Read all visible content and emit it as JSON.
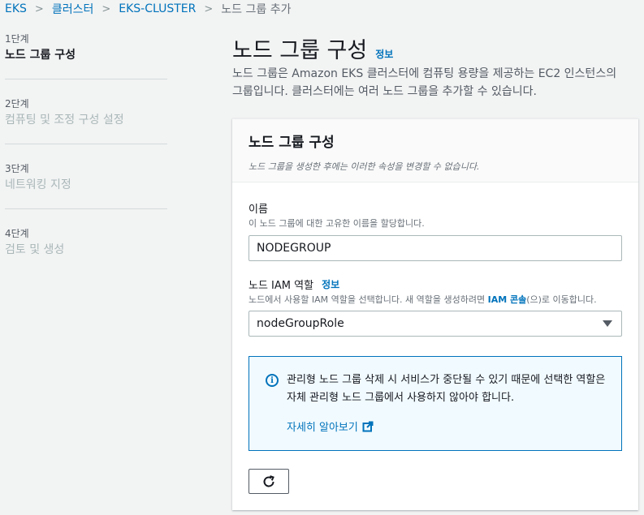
{
  "breadcrumb": {
    "items": [
      "EKS",
      "클러스터",
      "EKS-CLUSTER"
    ],
    "current": "노드 그룹 추가"
  },
  "steps": [
    {
      "num": "1단계",
      "label": "노드 그룹 구성",
      "active": true
    },
    {
      "num": "2단계",
      "label": "컴퓨팅 및 조정 구성 설정",
      "active": false
    },
    {
      "num": "3단계",
      "label": "네트워킹 지정",
      "active": false
    },
    {
      "num": "4단계",
      "label": "검토 및 생성",
      "active": false
    }
  ],
  "page": {
    "title": "노드 그룹 구성",
    "info": "정보",
    "desc_line1": "노드 그룹은 Amazon EKS 클러스터에 컴퓨팅 용량을 제공하는 EC2 인스턴스의",
    "desc_line2": "그룹입니다. 클러스터에는 여러 노드 그룹을 추가할 수 있습니다."
  },
  "panel": {
    "title": "노드 그룹 구성",
    "subtitle": "노드 그룹을 생성한 후에는 이러한 속성을 변경할 수 없습니다."
  },
  "name_field": {
    "label": "이름",
    "desc": "이 노드 그룹에 대한 고유한 이름을 할당합니다.",
    "value": "NODEGROUP"
  },
  "role_field": {
    "label": "노드 IAM 역할",
    "info": "정보",
    "desc_before": "노드에서 사용할 IAM 역할을 선택합니다. 새 역할을 생성하려면 ",
    "desc_link": "IAM 콘솔",
    "desc_after": "(으)로 이동합니다.",
    "value": "nodeGroupRole"
  },
  "alert": {
    "text": "관리형 노드 그룹 삭제 시 서비스가 중단될 수 있기 때문에 선택한 역할은 자체 관리형 노드 그룹에서 사용하지 않아야 합니다.",
    "link": "자세히 알아보기",
    "icon": "info-icon"
  },
  "colors": {
    "link": "#0073bb",
    "background": "#f2f3f3",
    "alert_bg": "#f1faff"
  }
}
